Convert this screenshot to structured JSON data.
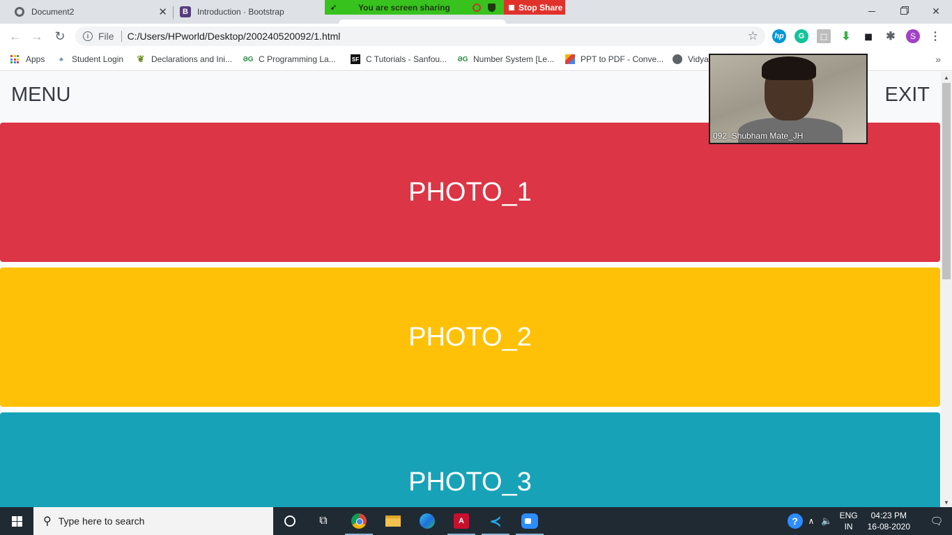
{
  "browser": {
    "tabs": [
      {
        "title": "Document2",
        "close": "✕"
      },
      {
        "title": "Introduction · Bootstrap",
        "favicon_letter": "B"
      }
    ],
    "window_controls": {
      "close": "✕"
    },
    "omnibox": {
      "scheme_label": "File",
      "url": "C:/Users/HPworld/Desktop/200240520092/1.html"
    },
    "extensions": {
      "hp": "hp",
      "grammarly": "G",
      "profile_initial": "S"
    },
    "bookmarks": [
      {
        "label": "Apps"
      },
      {
        "label": "Student Login"
      },
      {
        "label": "Declarations and Ini..."
      },
      {
        "label": "C Programming La..."
      },
      {
        "label": "C Tutorials - Sanfou...",
        "icon_text": "SF"
      },
      {
        "label": "Number System [Le..."
      },
      {
        "label": "PPT to PDF - Conve..."
      },
      {
        "label": "Vidya"
      }
    ]
  },
  "zoom": {
    "sharing_text": "You are screen sharing",
    "stop_label": "Stop Share",
    "video_name": "092_Shubham Mate_JH"
  },
  "page": {
    "navbar": {
      "left": "MENU",
      "right": "EXIT"
    },
    "photos": [
      {
        "label": "PHOTO_1",
        "color": "#dc3545"
      },
      {
        "label": "PHOTO_2",
        "color": "#ffc107"
      },
      {
        "label": "PHOTO_3",
        "color": "#17a2b8"
      }
    ]
  },
  "taskbar": {
    "search_placeholder": "Type here to search",
    "tray": {
      "lang_top": "ENG",
      "lang_bottom": "IN",
      "time": "04:23 PM",
      "date": "16-08-2020"
    }
  },
  "colors": {
    "apps_grid": [
      "#ea4335",
      "#fbbc05",
      "#34a853",
      "#4285f4",
      "#ea4335",
      "#fbbc05",
      "#34a853",
      "#4285f4",
      "#ea4335"
    ]
  }
}
